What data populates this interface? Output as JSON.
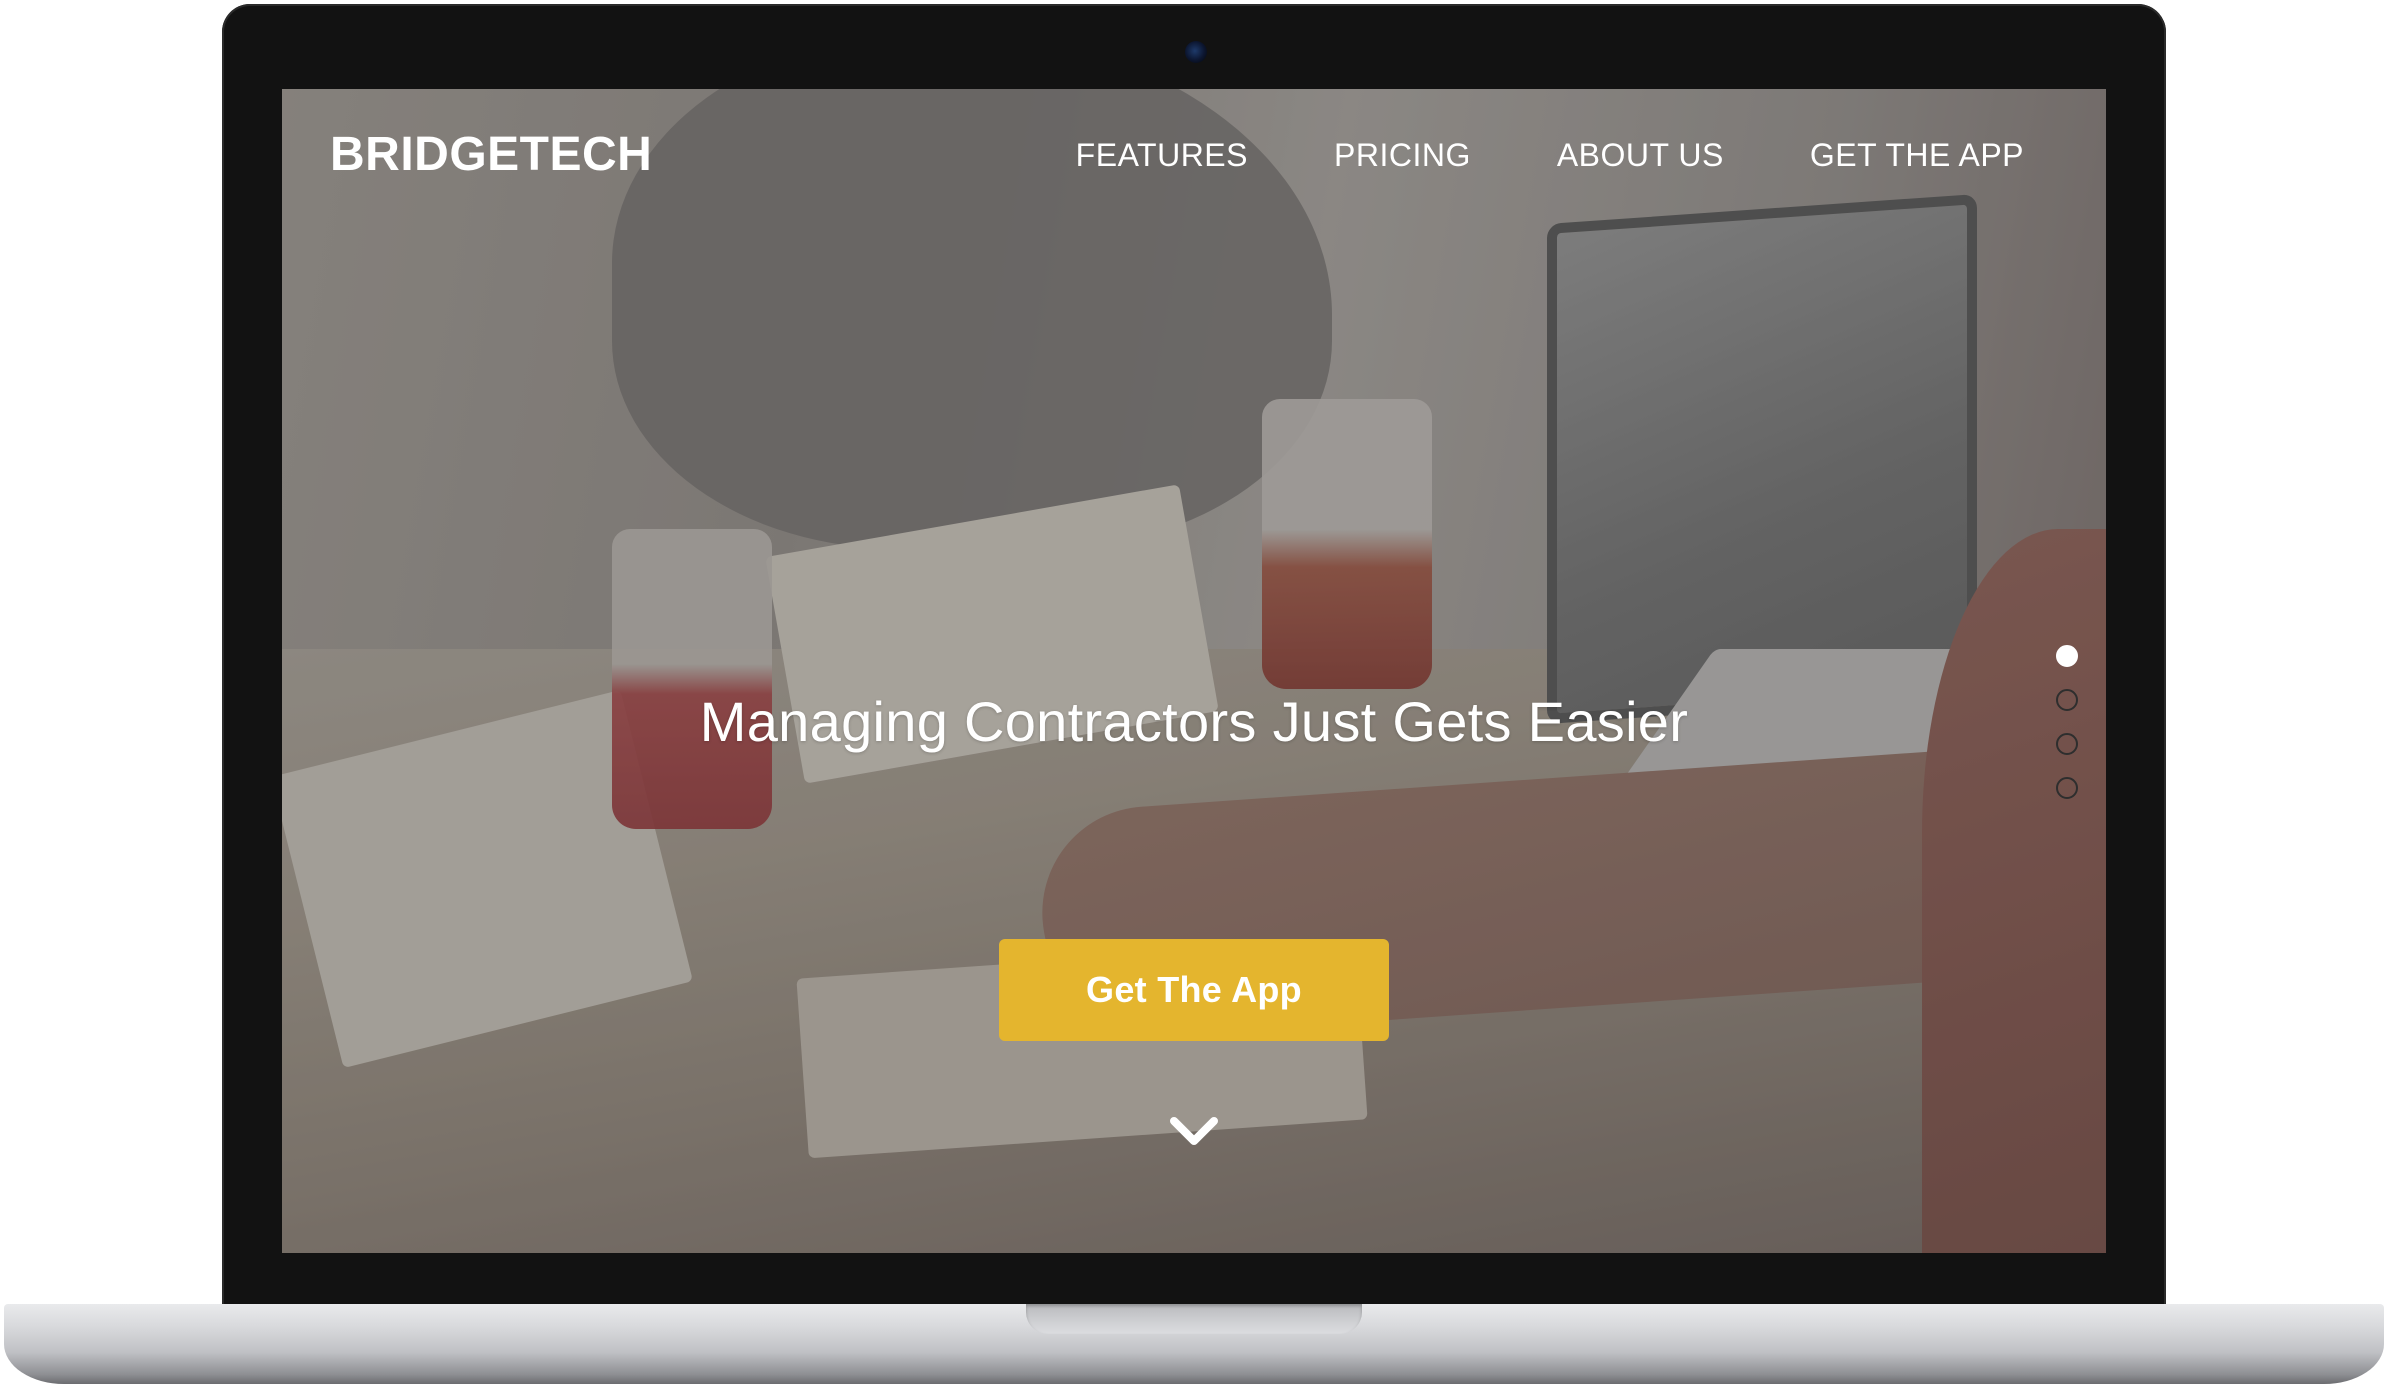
{
  "brand": {
    "logo_text": "BRIDGETECH"
  },
  "nav": {
    "items": [
      {
        "label": "FEATURES"
      },
      {
        "label": "PRICING"
      },
      {
        "label": "ABOUT US"
      },
      {
        "label": "GET THE APP"
      }
    ]
  },
  "hero": {
    "headline": "Managing Contractors Just Gets Easier",
    "cta_label": "Get The App",
    "scroll_icon": "chevron-down-icon"
  },
  "slider": {
    "slide_count": 4,
    "active_index": 0
  },
  "colors": {
    "cta_background": "#e4b52e",
    "text": "#ffffff",
    "laptop_bezel": "#121212"
  }
}
